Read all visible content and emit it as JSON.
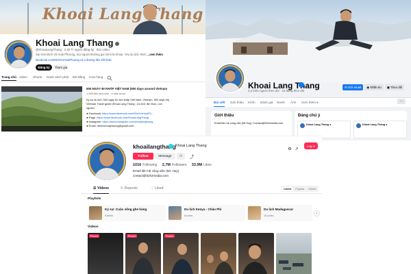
{
  "youtube": {
    "banner_text": "Khoai Lang Thang",
    "channel_name": "Khoai Lang Thang",
    "meta": "@KhoaiLangThang · 2,93 Tr người đăng ký · 921 video",
    "desc": "Sài Gòn Đinh Vũ Hoài Phương, mọi người thường gọi mình là Khoai. Yêu du lịch, thích",
    "desc_more": "...xem thêm",
    "link": "facebook.com/DinhVuHoaiPhuong và 2 đường liên kết khác",
    "subscribe_label": "Đăng ký",
    "join_label": "Tham gia",
    "tabs": [
      "Trang chủ",
      "Video",
      "Shorts",
      "Danh sách phát",
      "Bài đăng",
      "Cửa hàng"
    ],
    "video": {
      "title": "500 NGÀY ĐI KHẮP VIỆT NAM (500 days around Vietnam",
      "meta": "1.495.560 lượt xem · 4 năm trước",
      "lines": [
        {
          "text": "Ký sự du lịch: 500 ngày Du lịch khắp Việt Nam. Vietnam: 500 days trip",
          "link": ""
        },
        {
          "text": "Vietnam Travel guide (Khoai Lang Thang - Du lịch, ẩm thực, con",
          "link": ""
        },
        {
          "text": "người)",
          "link": ""
        },
        {
          "text": "►Facebook: ",
          "link": "https://www.facebook.com/DinhVuHoaiPh..."
        },
        {
          "text": "►Page: ",
          "link": "https://www.facebook.com/KhoaiLangThang"
        },
        {
          "text": "►Instagram: ",
          "link": "https://www.instagram.com/khoailangthang"
        },
        {
          "text": "►Email: dinhvuhoaiphuong@gmail.com...",
          "link": ""
        }
      ]
    }
  },
  "facebook": {
    "name": "Khoai Lang Thang",
    "stats": "3,3 triệu người theo dõi · 16 đang theo dõi",
    "email_btn": "Gửi email",
    "msg_btn": "Nhắn tin",
    "follow_btn": "Theo dõi",
    "tabs": [
      "Bài viết",
      "Giới thiệu",
      "Kênh",
      "Đánh giá",
      "Reels",
      "Ảnh",
      "Xem thêm ▾"
    ],
    "intro_title": "Giới thiệu",
    "intro_text": "Email liên hệ công việc (Mr.Huy): Contact@52hzmedia.com",
    "featured_title": "Đáng chú ý",
    "featured_posts": [
      "Khoai Lang Thang ●",
      "Khoai Lang Thang ●"
    ]
  },
  "tiktok": {
    "username": "khoailangthang",
    "nickname": "Khoai Lang Thang",
    "follow_label": "Follow",
    "message_label": "Message",
    "following_count": "1016",
    "following_label": "Following",
    "followers_count": "2.7M",
    "followers_label": "Followers",
    "likes_count": "33.9M",
    "likes_label": "Likes",
    "bio_line1": "Email liên hệ công việc (Mr. Huy)",
    "bio_line2": "contact@52hzmedia.com",
    "login_label": "Log in",
    "tabs": [
      "☰ Videos",
      "↻ Reposts",
      "♡ Liked"
    ],
    "sort_options": [
      "Latest",
      "Popular",
      "Oldest"
    ],
    "playlists_label": "Playlists",
    "playlists": [
      {
        "title": "Ký sự: Cuộc sống ghe hàng",
        "count": "6 posts"
      },
      {
        "title": "Du lịch Kenya - Châu Phi",
        "count": "8 posts"
      },
      {
        "title": "Du lịch Madagascar",
        "count": "10 posts"
      }
    ],
    "videos_label": "Videos",
    "pinned_label": "Pinned"
  },
  "colors": {
    "yt_link": "#065fd4",
    "fb_blue": "#1877f2",
    "tt_red": "#fe2c55",
    "tt_cyan": "#20d5ec"
  }
}
